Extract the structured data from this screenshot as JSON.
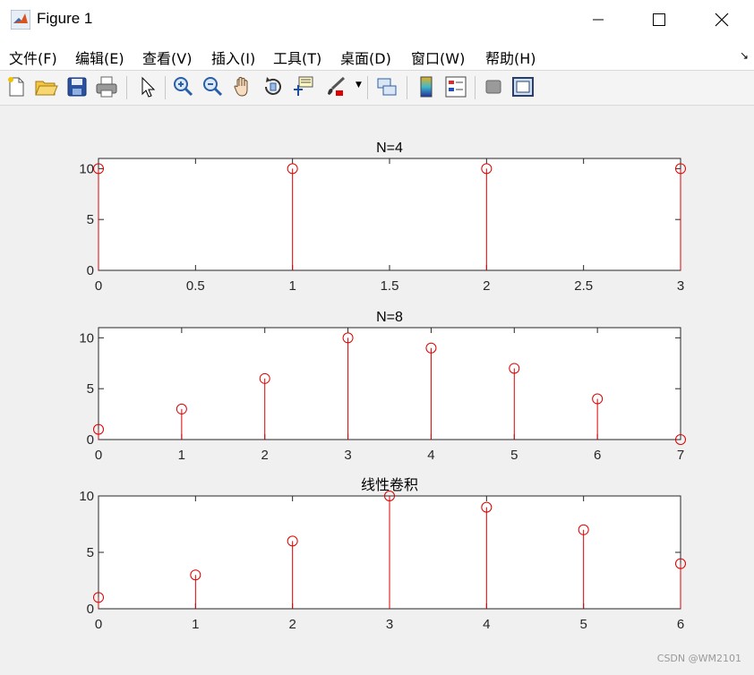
{
  "window": {
    "title": "Figure 1"
  },
  "menu": [
    "文件(F)",
    "编辑(E)",
    "查看(V)",
    "插入(I)",
    "工具(T)",
    "桌面(D)",
    "窗口(W)",
    "帮助(H)"
  ],
  "toolbar": [
    "new-figure-icon",
    "open-icon",
    "save-icon",
    "print-icon",
    "pointer-icon",
    "zoom-in-icon",
    "zoom-out-icon",
    "pan-icon",
    "rotate-icon",
    "data-cursor-icon",
    "brush-icon",
    "link-icon",
    "colorbar-icon",
    "legend-icon",
    "hide-plot-tools-icon",
    "show-plot-tools-icon"
  ],
  "watermark": "CSDN @WM2101",
  "colors": {
    "stem": "#dd0000",
    "axis": "#262626"
  },
  "chart_data": [
    {
      "type": "stem",
      "title": "N=4",
      "x": [
        0,
        1,
        2,
        3
      ],
      "values": [
        10,
        10,
        10,
        10
      ],
      "xlim": [
        0,
        3
      ],
      "ylim": [
        0,
        11
      ],
      "xticks": [
        "0",
        "0.5",
        "1",
        "1.5",
        "2",
        "2.5",
        "3"
      ],
      "xtick_values": [
        0,
        0.5,
        1,
        1.5,
        2,
        2.5,
        3
      ],
      "yticks": [
        "0",
        "5",
        "10"
      ],
      "ytick_values": [
        0,
        5,
        10
      ]
    },
    {
      "type": "stem",
      "title": "N=8",
      "x": [
        0,
        1,
        2,
        3,
        4,
        5,
        6,
        7
      ],
      "values": [
        1,
        3,
        6,
        10,
        9,
        7,
        4,
        0
      ],
      "xlim": [
        0,
        7
      ],
      "ylim": [
        0,
        11
      ],
      "xticks": [
        "0",
        "1",
        "2",
        "3",
        "4",
        "5",
        "6",
        "7"
      ],
      "xtick_values": [
        0,
        1,
        2,
        3,
        4,
        5,
        6,
        7
      ],
      "yticks": [
        "0",
        "5",
        "10"
      ],
      "ytick_values": [
        0,
        5,
        10
      ]
    },
    {
      "type": "stem",
      "title": "线性卷积",
      "x": [
        0,
        1,
        2,
        3,
        4,
        5,
        6
      ],
      "values": [
        1,
        3,
        6,
        10,
        9,
        7,
        4
      ],
      "xlim": [
        0,
        6
      ],
      "ylim": [
        0,
        10
      ],
      "xticks": [
        "0",
        "1",
        "2",
        "3",
        "4",
        "5",
        "6"
      ],
      "xtick_values": [
        0,
        1,
        2,
        3,
        4,
        5,
        6
      ],
      "yticks": [
        "0",
        "5",
        "10"
      ],
      "ytick_values": [
        0,
        5,
        10
      ]
    }
  ]
}
